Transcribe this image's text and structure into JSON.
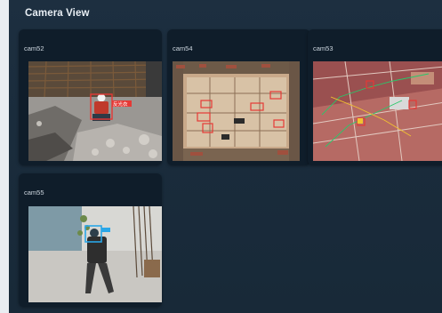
{
  "panel": {
    "title": "Camera View"
  },
  "cameras": [
    {
      "label": "cam52",
      "detections": [
        {
          "label": "反光衣",
          "color": "#e53935"
        }
      ]
    },
    {
      "label": "cam54",
      "detections": []
    },
    {
      "label": "cam53",
      "detections": []
    },
    {
      "label": "cam55",
      "detections": []
    }
  ],
  "colors": {
    "panel_bg": "#1b2d3d",
    "card_bg": "#0f1d2a",
    "detection_red": "#e53935",
    "detection_blue": "#2aa7e8",
    "detection_green": "#27c96a"
  }
}
